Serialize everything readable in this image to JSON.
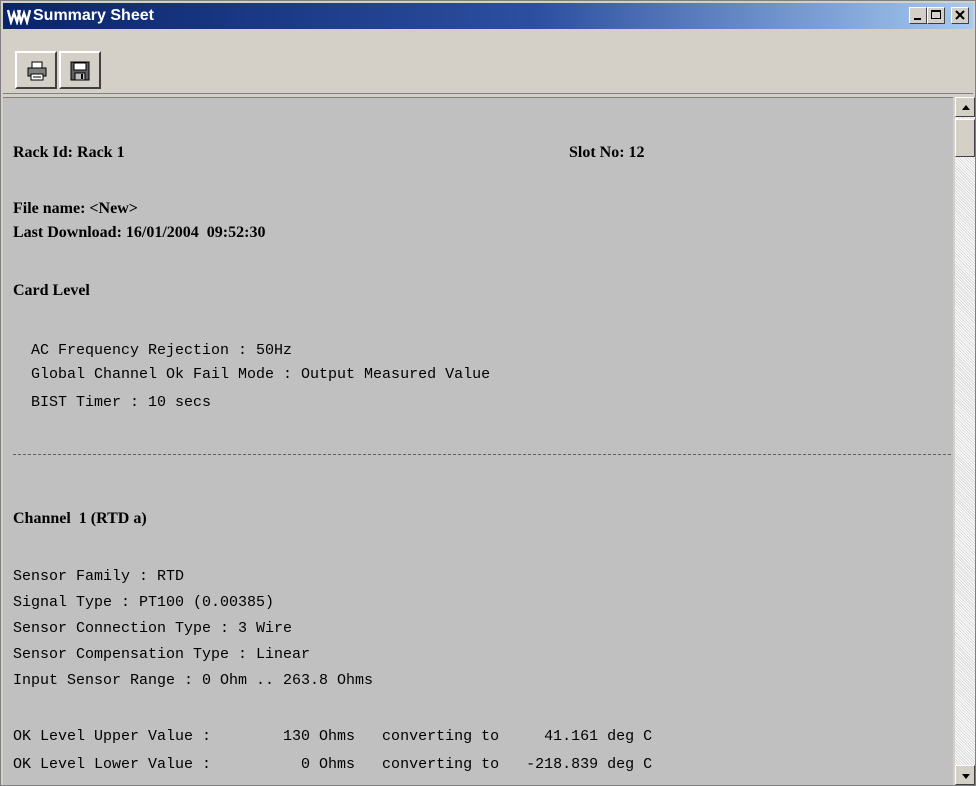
{
  "window": {
    "title": "Summary Sheet",
    "app_icon": "ww-logo-icon",
    "controls": [
      "minimize-icon",
      "maximize-icon",
      "close-icon"
    ]
  },
  "toolbar": {
    "buttons": [
      {
        "name": "print-button",
        "icon": "printer-icon"
      },
      {
        "name": "save-button",
        "icon": "floppy-disk-icon"
      }
    ]
  },
  "sheet": {
    "rack_id": "Rack Id: Rack 1",
    "slot_no": "Slot No: 12",
    "file_name": "File name: <New>",
    "last_download": "Last Download: 16/01/2004  09:52:30",
    "card_level_heading": "Card Level",
    "card_level_lines": [
      "  AC Frequency Rejection : 50Hz",
      "  Global Channel Ok Fail Mode : Output Measured Value",
      "  BIST Timer : 10 secs"
    ],
    "channel_heading": "Channel  1 (RTD a)",
    "channel_lines": [
      "Sensor Family : RTD",
      "Signal Type : PT100 (0.00385)",
      "Sensor Connection Type : 3 Wire",
      "Sensor Compensation Type : Linear",
      "Input Sensor Range : 0 Ohm .. 263.8 Ohms"
    ],
    "ok_levels": [
      "OK Level Upper Value :        130 Ohms   converting to     41.161 deg C",
      "OK Level Lower Value :          0 Ohms   converting to   -218.839 deg C"
    ]
  },
  "colors": {
    "titlebar_start": "#0a246a",
    "titlebar_end": "#a6caf0",
    "content_bg": "#c0c0c0",
    "chrome": "#d4d0c8"
  }
}
